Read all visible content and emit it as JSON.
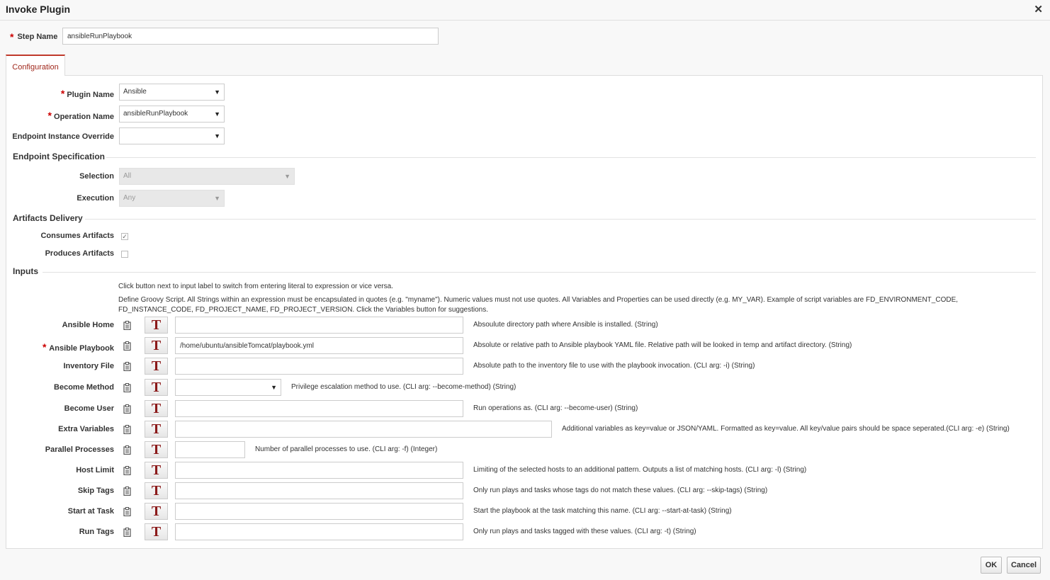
{
  "dialog": {
    "title": "Invoke Plugin",
    "close_glyph": "✕"
  },
  "step_name": {
    "label": "Step Name",
    "value": "ansibleRunPlaybook"
  },
  "tab": {
    "label": "Configuration"
  },
  "config": {
    "plugin_name": {
      "label": "Plugin Name",
      "value": "Ansible"
    },
    "operation_name": {
      "label": "Operation Name",
      "value": "ansibleRunPlaybook"
    },
    "endpoint_override": {
      "label": "Endpoint Instance Override",
      "value": ""
    }
  },
  "endpoint_spec": {
    "title": "Endpoint Specification",
    "selection": {
      "label": "Selection",
      "value": "All"
    },
    "execution": {
      "label": "Execution",
      "value": "Any"
    }
  },
  "artifacts": {
    "title": "Artifacts Delivery",
    "consumes": {
      "label": "Consumes Artifacts",
      "checked": true
    },
    "produces": {
      "label": "Produces Artifacts",
      "checked": false
    }
  },
  "inputs": {
    "title": "Inputs",
    "note1": "Click button next to input label to switch from entering literal to expression or vice versa.",
    "note2": "Define Groovy Script. All Strings within an expression must be encapsulated in quotes (e.g. \"myname\"). Numeric values must not use quotes. All Variables and Properties can be used directly (e.g. MY_VAR). Example of script variables are FD_ENVIRONMENT_CODE, FD_INSTANCE_CODE, FD_PROJECT_NAME, FD_PROJECT_VERSION. Click the Variables button for suggestions.",
    "toggle_glyph": "T",
    "rows": [
      {
        "label": "Ansible Home",
        "value": "",
        "desc": "Absoulute directory path where Ansible is installed. (String)"
      },
      {
        "label": "Ansible Playbook",
        "value": "/home/ubuntu/ansibleTomcat/playbook.yml",
        "desc": "Absolute or relative path to Ansible playbook YAML file. Relative path will be looked in temp and artifact directory. (String)"
      },
      {
        "label": "Inventory File",
        "value": "",
        "desc": "Absolute path to the inventory file to use with the playbook invocation. (CLI arg: -i) (String)"
      },
      {
        "label": "Become Method",
        "value": "",
        "desc": "Privilege escalation method to use. (CLI arg: --become-method) (String)"
      },
      {
        "label": "Become User",
        "value": "",
        "desc": "Run operations as. (CLI arg: --become-user) (String)"
      },
      {
        "label": "Extra Variables",
        "value": "",
        "desc": "Additional variables as key=value or JSON/YAML. Formatted as key=value. All key/value pairs should be space seperated.(CLI arg: -e) (String)"
      },
      {
        "label": "Parallel Processes",
        "value": "",
        "desc": "Number of parallel processes to use. (CLI arg: -f) (Integer)"
      },
      {
        "label": "Host Limit",
        "value": "",
        "desc": "Limiting of the selected hosts to an additional pattern. Outputs a list of matching hosts. (CLI arg: -l) (String)"
      },
      {
        "label": "Skip Tags",
        "value": "",
        "desc": "Only run plays and tasks whose tags do not match these values. (CLI arg: --skip-tags) (String)"
      },
      {
        "label": "Start at Task",
        "value": "",
        "desc": "Start the playbook at the task matching this name. (CLI arg: --start-at-task) (String)"
      },
      {
        "label": "Run Tags",
        "value": "",
        "desc": "Only run plays and tasks tagged with these values. (CLI arg: -t) (String)"
      }
    ]
  },
  "footer": {
    "ok": "OK",
    "cancel": "Cancel"
  },
  "colors": {
    "required": "#cc0000",
    "tab_accent": "#c0392b",
    "toggle_text": "#8b1a1a"
  }
}
